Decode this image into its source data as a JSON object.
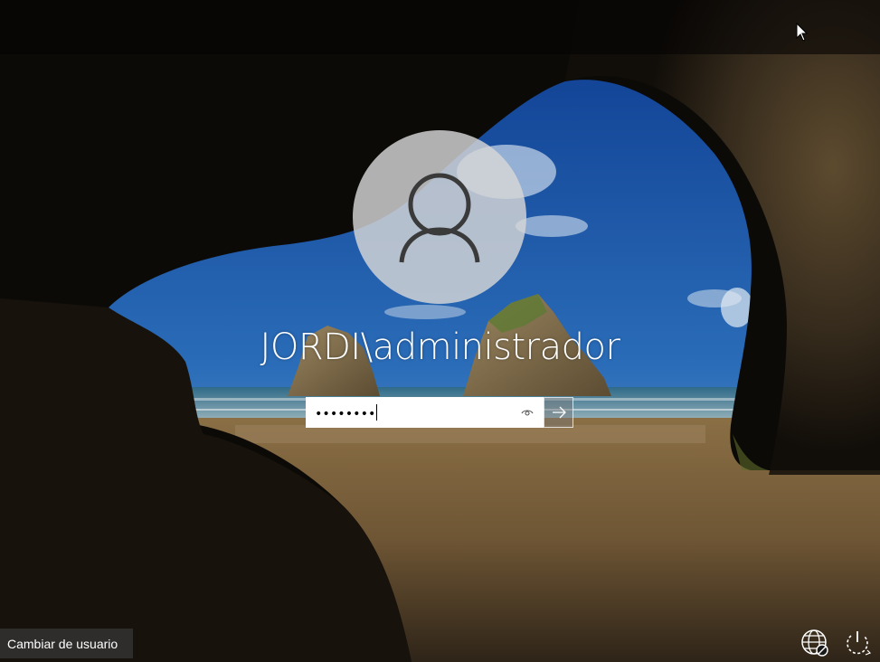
{
  "login": {
    "username": "JORDI\\administrador",
    "password_masked": "••••••••"
  },
  "footer": {
    "switch_user_label": "Cambiar de usuario"
  },
  "icons": {
    "avatar": "user-silhouette-icon",
    "reveal": "eye-icon",
    "submit": "arrow-right-icon",
    "network": "globe-network-icon",
    "power": "power-icon",
    "cursor": "mouse-pointer-icon"
  }
}
